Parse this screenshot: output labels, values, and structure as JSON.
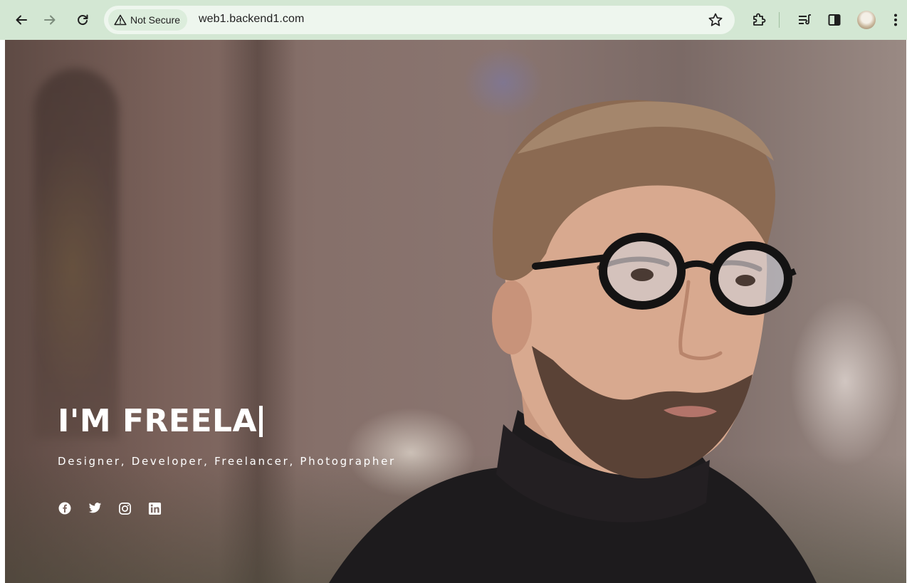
{
  "browser": {
    "security_label": "Not Secure",
    "url": "web1.backend1.com",
    "icons": [
      "back-arrow-icon",
      "forward-arrow-icon",
      "reload-icon",
      "warning-icon",
      "bookmark-star-icon",
      "extensions-icon",
      "reading-list-icon",
      "side-panel-icon",
      "profile-avatar",
      "more-menu-icon"
    ]
  },
  "hero": {
    "headline": "I'M FREELA",
    "subline": "Designer, Developer, Freelancer, Photographer",
    "socials": [
      {
        "icon": "facebook-icon"
      },
      {
        "icon": "twitter-icon"
      },
      {
        "icon": "instagram-icon"
      },
      {
        "icon": "linkedin-icon"
      }
    ]
  },
  "colors": {
    "chrome_bg": "#d3e7d3",
    "omnibox_bg": "#eef6ee",
    "hero_text": "#ffffff"
  }
}
